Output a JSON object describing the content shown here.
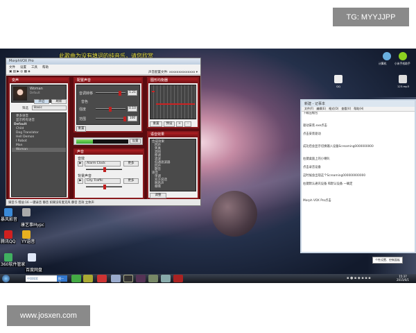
{
  "watermarks": {
    "top": "TG: MYYJJPP",
    "bottom": "www.josxen.com"
  },
  "lyric_banner": "此歌曲为没有填词的纯音乐，请您欣赏",
  "app": {
    "title": "MorphVOX Pro",
    "menu": [
      "文件",
      "设置",
      "工具",
      "帮助"
    ],
    "profile_label": "声音配置文件:",
    "profile_value": "xxxxxxxxxxxxxx",
    "voice_panel": {
      "title": "变声",
      "voice_name": "Woman",
      "voice_sub": "Default",
      "listen_btn": "开启",
      "record_btn": "刷新",
      "filter_label": "筛选",
      "filter_value": "Basic",
      "list": [
        "更多语音",
        "显示所有语音",
        "Default",
        "Child",
        "Dog Translator",
        "Hell Demon",
        "I Robot",
        "Man",
        "Woman"
      ]
    },
    "tweak_panel": {
      "title": "配置声音",
      "pitch_label": "音调转移",
      "pitch_value": "1.21",
      "timbre_label": "音色",
      "strength_label": "强度",
      "strength_value": "0.10",
      "amount_label": "范围",
      "amount_value": "100",
      "reset": "重置"
    },
    "level_btn": "设置",
    "sound_panel": {
      "title": "声音",
      "sound_label": "音效",
      "sound_value": "Alarm Clock",
      "more": "更多",
      "bg_label": "背景声音",
      "bg_value": "City Traffic",
      "more2": "更多"
    },
    "eq_panel": {
      "title": "图形均衡器",
      "buttons": [
        "重置",
        "预设",
        "+",
        "-"
      ]
    },
    "effects_panel": {
      "title": "语音效果",
      "groups": [
        "合成效果",
        "回声",
        "失真",
        "混响",
        "移调",
        "滤波",
        "低通滤波器",
        "回声",
        "颤音",
        "语音",
        "单调",
        "双方说话",
        "喘息声",
        "嘶嘶"
      ],
      "settings": "调整"
    },
    "status": "调音:5  增益:16  一键录音 静音  如果没有麦克风 静音  音效 立体声"
  },
  "notepad": {
    "title": "新建 - 记事本",
    "menu": [
      "文件(F)",
      "编辑(E)",
      "格式(O)",
      "查看(V)",
      "帮助(H)"
    ],
    "lines": [
      "下载压缩包",
      "",
      "",
      "驱动安装.exe点击",
      "",
      "点击安装驱动",
      "",
      "",
      "成功后会显示切换输入设备Screaming0000000000",
      "",
      "",
      "右键桌面上的小喇叭",
      "",
      "点击录音设备",
      "",
      "这时候会出现这个Screaming000000000000",
      "",
      "右键默认通讯设备 和默认设备 一确定",
      "",
      "",
      "",
      "Morph VOX Pro点击"
    ]
  },
  "tooltip": "个性设置、控制面板",
  "desktop_icons": [
    "暴风影音",
    "康艺事Mypc",
    "腾讯QQ",
    "YY语音",
    "360软件管家",
    "百度网盘",
    "计算机",
    "小米手机助手",
    "QQ",
    "123.mp3"
  ],
  "taskbar": {
    "search_placeholder": "中国搜索",
    "search_btn": "搜一下",
    "clock_time": "15:37",
    "clock_date": "2015/6/1"
  }
}
